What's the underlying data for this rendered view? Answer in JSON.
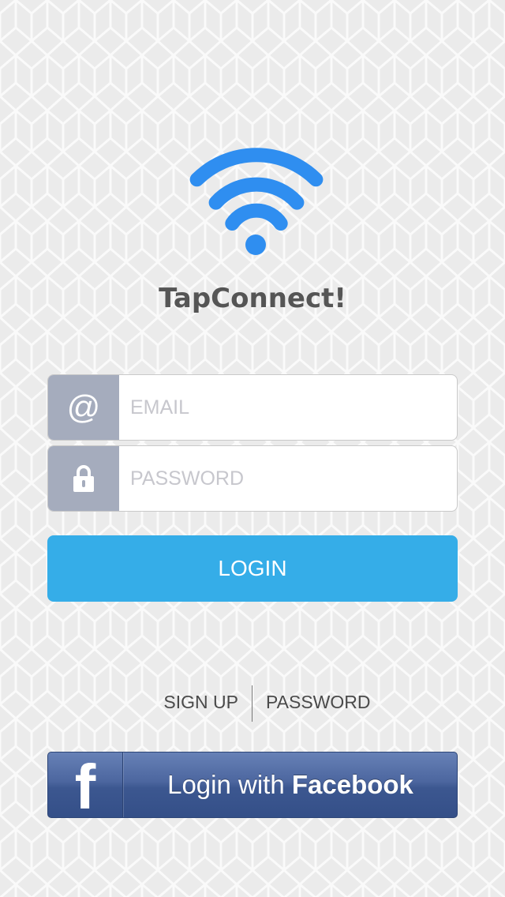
{
  "app": {
    "title": "TapConnect!",
    "accent_color": "#2f8ef0"
  },
  "logo": {
    "icon": "wifi-icon"
  },
  "form": {
    "email": {
      "icon": "at-icon",
      "icon_glyph": "@",
      "placeholder": "EMAIL",
      "value": ""
    },
    "password": {
      "icon": "lock-icon",
      "placeholder": "PASSWORD",
      "value": ""
    },
    "field_icon_bg": "#a5acbd"
  },
  "login_button": {
    "label": "LOGIN",
    "color": "#35ade8"
  },
  "links": {
    "signup_label": "SIGN UP",
    "password_label": "PASSWORD"
  },
  "facebook_button": {
    "icon": "facebook-icon",
    "icon_glyph": "f",
    "label_prefix": "Login with ",
    "label_brand": "Facebook",
    "color": "#3b5998"
  }
}
